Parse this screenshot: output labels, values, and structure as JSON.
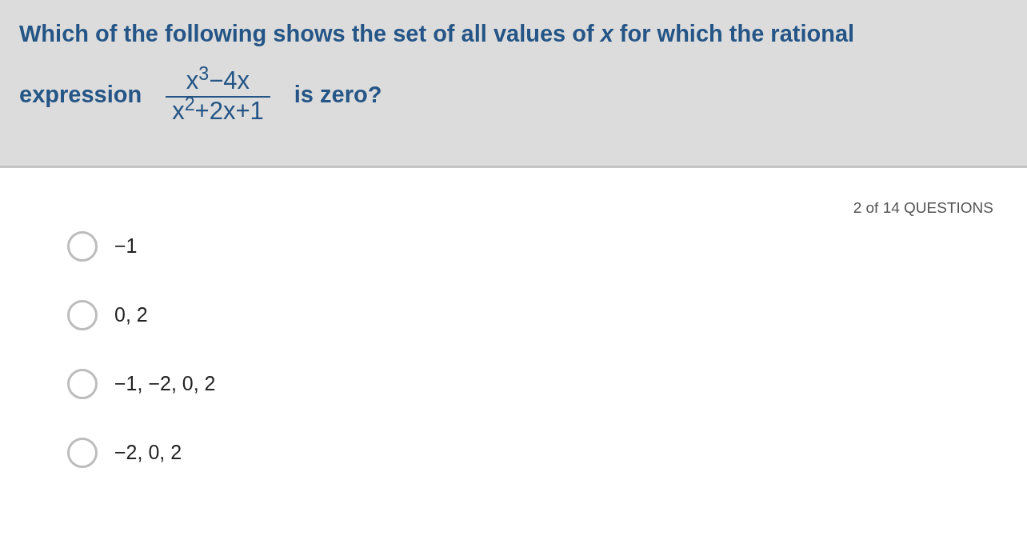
{
  "question": {
    "text_before": "Which of the following shows the set of all values of *x* for which the rational expression",
    "fraction": {
      "numerator": "x$^{3}$−4x",
      "denominator": "x$^{2}$+2x+1"
    },
    "text_after": "is zero?"
  },
  "progress": "2 of 14 QUESTIONS",
  "options": [
    {
      "label": "−1",
      "selected": false
    },
    {
      "label": "0, 2",
      "selected": false
    },
    {
      "label": "−1, −2, 0, 2",
      "selected": false
    },
    {
      "label": "−2, 0, 2",
      "selected": false
    }
  ]
}
